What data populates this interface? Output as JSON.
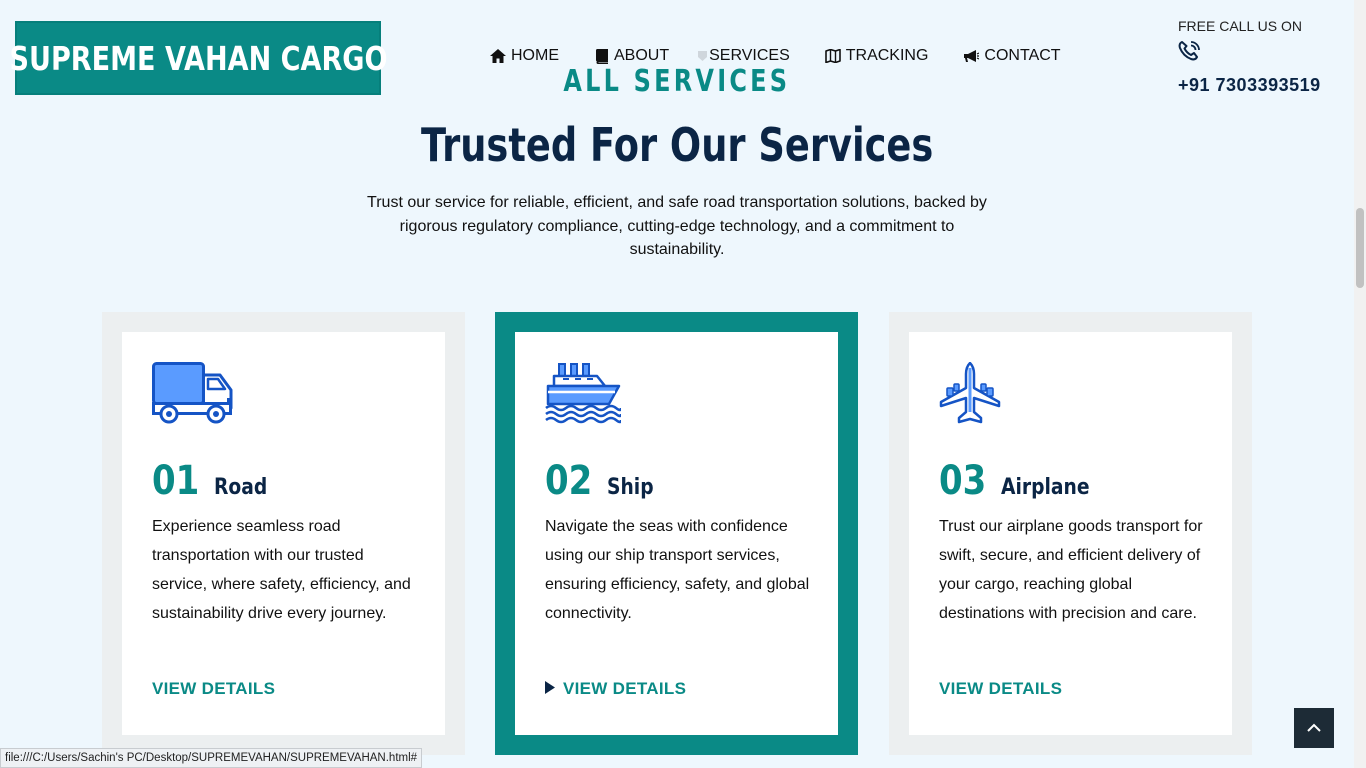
{
  "brand": {
    "logo_text": "SUPREME VAHAN CARGO",
    "color": "#0a8a86",
    "dark": "#0b2545"
  },
  "nav": {
    "items": [
      {
        "label": "HOME",
        "icon": "home-icon"
      },
      {
        "label": "ABOUT",
        "icon": "book-icon"
      },
      {
        "label": "SERVICES",
        "icon": "services-icon"
      },
      {
        "label": "TRACKING",
        "icon": "map-icon"
      },
      {
        "label": "CONTACT",
        "icon": "megaphone-icon"
      }
    ]
  },
  "contact": {
    "label": "FREE CALL US ON",
    "icon": "phone-icon",
    "phone": "+91 7303393519"
  },
  "section": {
    "kicker": "ALL SERVICES",
    "title": "Trusted For Our Services",
    "subtitle": "Trust our service for reliable, efficient, and safe road transportation solutions, backed by rigorous regulatory compliance, cutting-edge technology, and a commitment to sustainability."
  },
  "cards": [
    {
      "num": "01",
      "name": "Road",
      "icon": "truck-icon",
      "text": "Experience seamless road transportation with our trusted service, where safety, efficiency, and sustainability drive every journey.",
      "link": "VIEW DETAILS"
    },
    {
      "num": "02",
      "name": "Ship",
      "icon": "ship-icon",
      "text": "Navigate the seas with confidence using our ship transport services, ensuring efficiency, safety, and global connectivity.",
      "link": "VIEW DETAILS"
    },
    {
      "num": "03",
      "name": "Airplane",
      "icon": "airplane-icon",
      "text": "Trust our airplane goods transport for swift, secure, and efficient delivery of your cargo, reaching global destinations with precision and care.",
      "link": "VIEW DETAILS"
    }
  ],
  "status_bar": {
    "url": "file:///C:/Users/Sachin's PC/Desktop/SUPREMEVAHAN/SUPREMEVAHAN.html#"
  }
}
